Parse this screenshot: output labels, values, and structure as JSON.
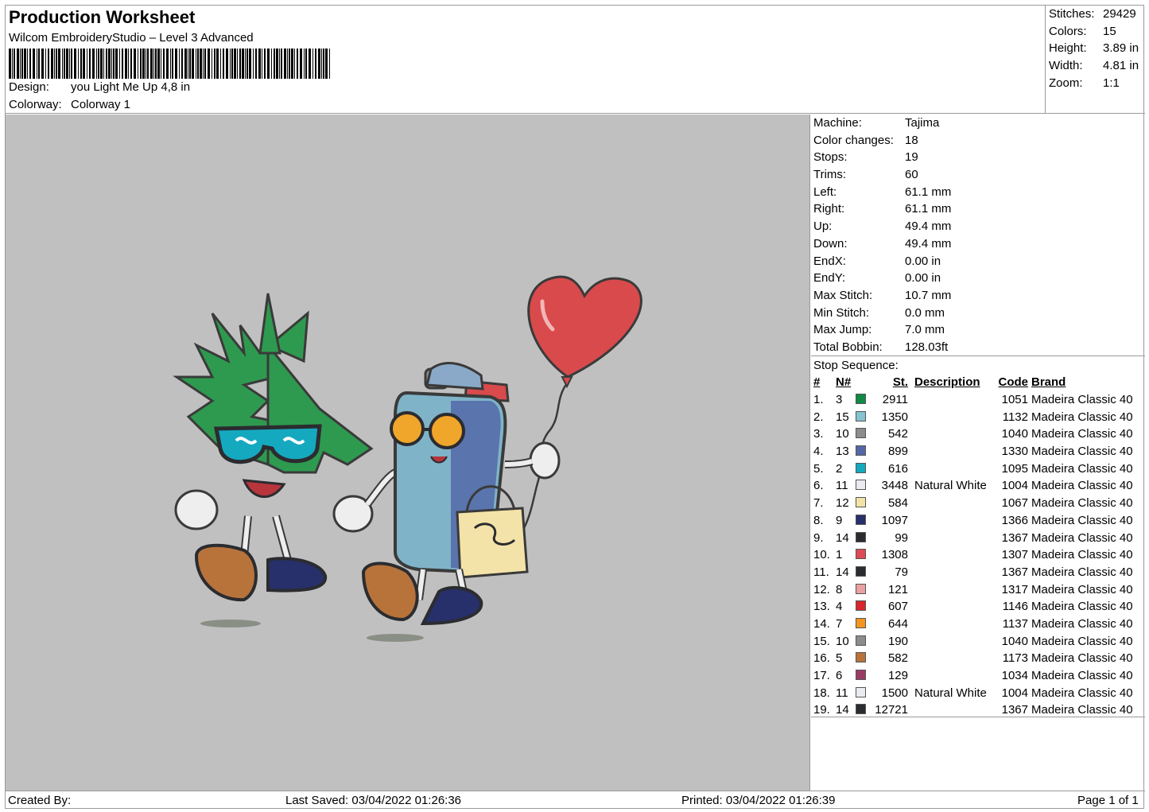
{
  "header": {
    "title": "Production Worksheet",
    "software": "Wilcom EmbroideryStudio – Level 3 Advanced",
    "design_label": "Design:",
    "design_value": "you Light Me Up 4,8 in",
    "colorway_label": "Colorway:",
    "colorway_value": "Colorway 1"
  },
  "stats": [
    {
      "label": "Stitches:",
      "value": "29429"
    },
    {
      "label": "Colors:",
      "value": "15"
    },
    {
      "label": "Height:",
      "value": "3.89 in"
    },
    {
      "label": "Width:",
      "value": "4.81 in"
    },
    {
      "label": "Zoom:",
      "value": "1:1"
    }
  ],
  "machine": [
    {
      "label": "Machine:",
      "value": "Tajima"
    },
    {
      "label": "Color changes:",
      "value": "18"
    },
    {
      "label": "Stops:",
      "value": "19"
    },
    {
      "label": "Trims:",
      "value": "60"
    },
    {
      "label": "Left:",
      "value": "61.1 mm"
    },
    {
      "label": "Right:",
      "value": "61.1 mm"
    },
    {
      "label": "Up:",
      "value": "49.4 mm"
    },
    {
      "label": "Down:",
      "value": "49.4 mm"
    },
    {
      "label": "EndX:",
      "value": "0.00 in"
    },
    {
      "label": "EndY:",
      "value": "0.00 in"
    },
    {
      "label": "Max Stitch:",
      "value": "10.7 mm"
    },
    {
      "label": "Min Stitch:",
      "value": "0.0 mm"
    },
    {
      "label": "Max Jump:",
      "value": "7.0 mm"
    },
    {
      "label": "Total Bobbin:",
      "value": "128.03ft"
    }
  ],
  "stop_sequence": {
    "title": "Stop Sequence:",
    "columns": {
      "idx": "#",
      "n": "N#",
      "st": "St.",
      "desc": "Description",
      "code": "Code",
      "brand": "Brand"
    },
    "rows": [
      {
        "idx": "1.",
        "n": "3",
        "color": "#0f8a45",
        "st": "2911",
        "desc": "",
        "code": "1051",
        "brand": "Madeira Classic 40"
      },
      {
        "idx": "2.",
        "n": "15",
        "color": "#86c2d0",
        "st": "1350",
        "desc": "",
        "code": "1132",
        "brand": "Madeira Classic 40"
      },
      {
        "idx": "3.",
        "n": "10",
        "color": "#8c8c8c",
        "st": "542",
        "desc": "",
        "code": "1040",
        "brand": "Madeira Classic 40"
      },
      {
        "idx": "4.",
        "n": "13",
        "color": "#5468a8",
        "st": "899",
        "desc": "",
        "code": "1330",
        "brand": "Madeira Classic 40"
      },
      {
        "idx": "5.",
        "n": "2",
        "color": "#14a9bf",
        "st": "616",
        "desc": "",
        "code": "1095",
        "brand": "Madeira Classic 40"
      },
      {
        "idx": "6.",
        "n": "11",
        "color": "#ebebf2",
        "st": "3448",
        "desc": "Natural White",
        "code": "1004",
        "brand": "Madeira Classic 40"
      },
      {
        "idx": "7.",
        "n": "12",
        "color": "#f4e3a8",
        "st": "584",
        "desc": "",
        "code": "1067",
        "brand": "Madeira Classic 40"
      },
      {
        "idx": "8.",
        "n": "9",
        "color": "#27306a",
        "st": "1097",
        "desc": "",
        "code": "1366",
        "brand": "Madeira Classic 40"
      },
      {
        "idx": "9.",
        "n": "14",
        "color": "#2b2c30",
        "st": "99",
        "desc": "",
        "code": "1367",
        "brand": "Madeira Classic 40"
      },
      {
        "idx": "10.",
        "n": "1",
        "color": "#de4a55",
        "st": "1308",
        "desc": "",
        "code": "1307",
        "brand": "Madeira Classic 40"
      },
      {
        "idx": "11.",
        "n": "14",
        "color": "#2b2c30",
        "st": "79",
        "desc": "",
        "code": "1367",
        "brand": "Madeira Classic 40"
      },
      {
        "idx": "12.",
        "n": "8",
        "color": "#eba1a3",
        "st": "121",
        "desc": "",
        "code": "1317",
        "brand": "Madeira Classic 40"
      },
      {
        "idx": "13.",
        "n": "4",
        "color": "#d9252b",
        "st": "607",
        "desc": "",
        "code": "1146",
        "brand": "Madeira Classic 40"
      },
      {
        "idx": "14.",
        "n": "7",
        "color": "#f7941d",
        "st": "644",
        "desc": "",
        "code": "1137",
        "brand": "Madeira Classic 40"
      },
      {
        "idx": "15.",
        "n": "10",
        "color": "#8c8c8c",
        "st": "190",
        "desc": "",
        "code": "1040",
        "brand": "Madeira Classic 40"
      },
      {
        "idx": "16.",
        "n": "5",
        "color": "#b8733b",
        "st": "582",
        "desc": "",
        "code": "1173",
        "brand": "Madeira Classic 40"
      },
      {
        "idx": "17.",
        "n": "6",
        "color": "#9c3a66",
        "st": "129",
        "desc": "",
        "code": "1034",
        "brand": "Madeira Classic 40"
      },
      {
        "idx": "18.",
        "n": "11",
        "color": "#ebebf2",
        "st": "1500",
        "desc": "Natural White",
        "code": "1004",
        "brand": "Madeira Classic 40"
      },
      {
        "idx": "19.",
        "n": "14",
        "color": "#2b2c30",
        "st": "12721",
        "desc": "",
        "code": "1367",
        "brand": "Madeira Classic 40"
      }
    ]
  },
  "footer": {
    "created_by": "Created By:",
    "last_saved": "Last Saved: 03/04/2022 01:26:36",
    "printed": "Printed: 03/04/2022 01:26:39",
    "page": "Page 1 of 1"
  },
  "colors": {
    "preview_background": "#c0c0c0",
    "leaf_green": "#2e9a4f",
    "heart_red": "#d84a4c",
    "lighter_blue": "#7fb3c8"
  }
}
